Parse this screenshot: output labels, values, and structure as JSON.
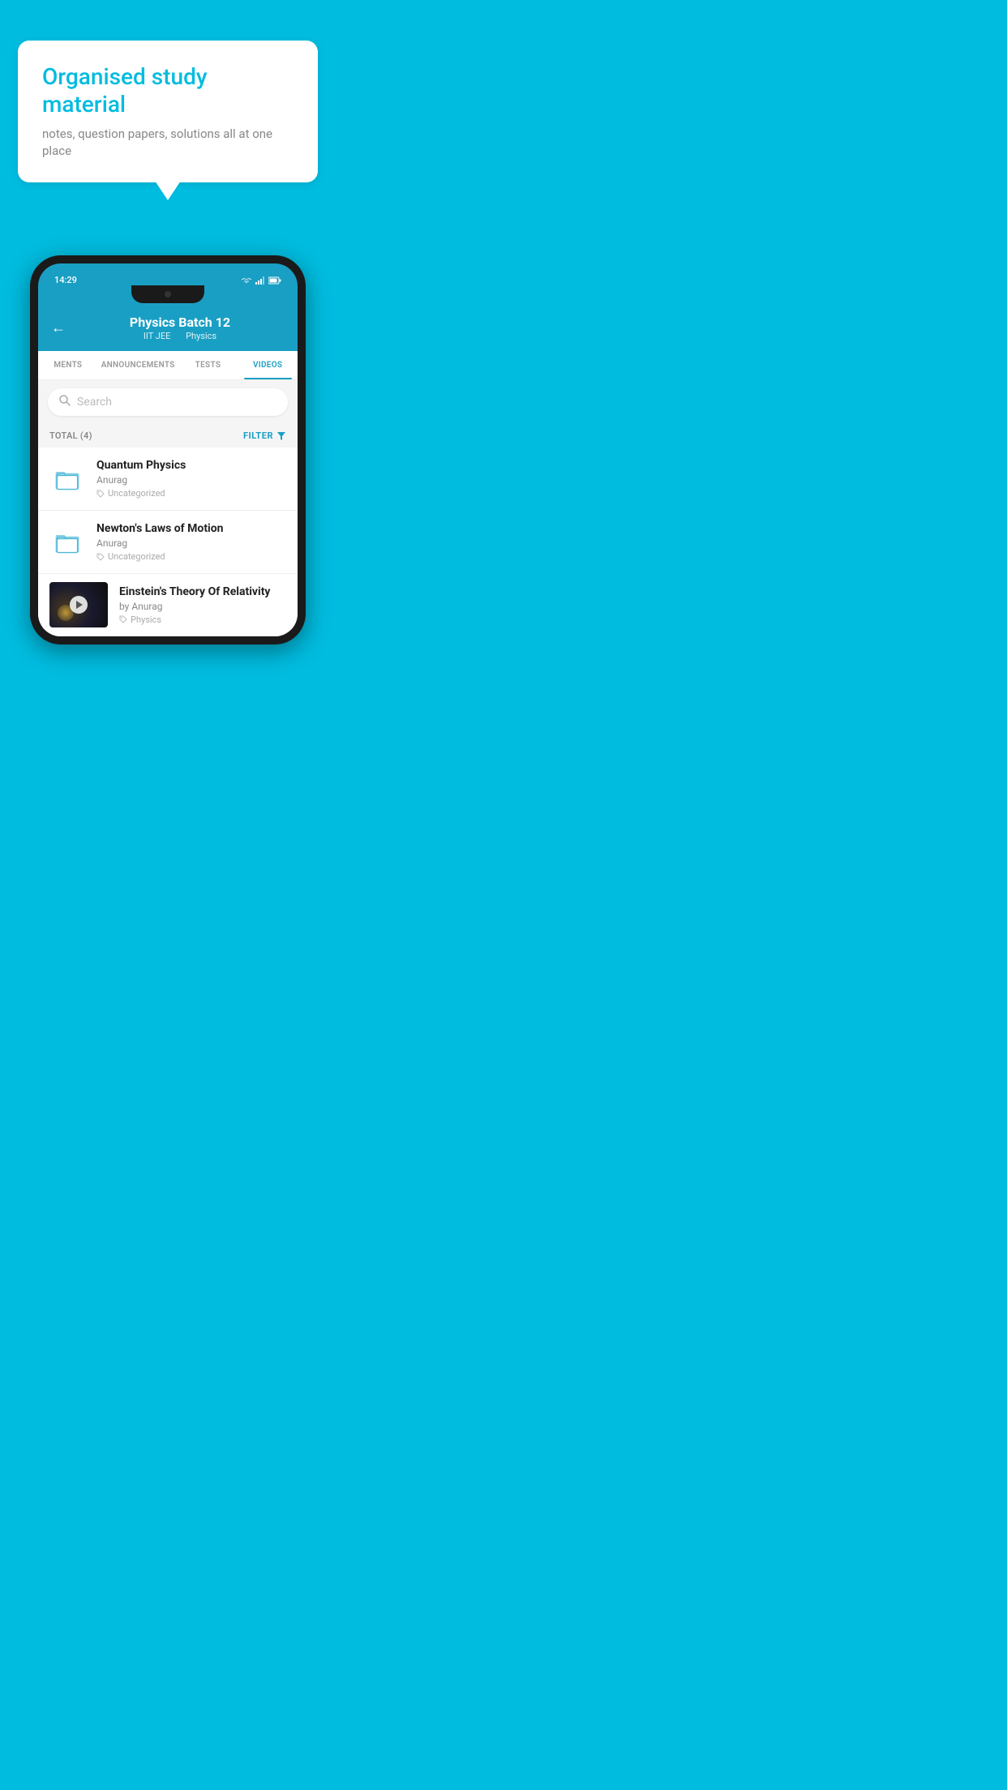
{
  "background_color": "#00BCDF",
  "speech_bubble": {
    "title": "Organised study material",
    "subtitle": "notes, question papers, solutions all at one place"
  },
  "phone": {
    "status_bar": {
      "time": "14:29",
      "icons": [
        "wifi",
        "signal",
        "battery"
      ]
    },
    "header": {
      "back_label": "←",
      "title": "Physics Batch 12",
      "subtitle_part1": "IIT JEE",
      "subtitle_part2": "Physics"
    },
    "tabs": [
      {
        "label": "MENTS",
        "active": false
      },
      {
        "label": "ANNOUNCEMENTS",
        "active": false
      },
      {
        "label": "TESTS",
        "active": false
      },
      {
        "label": "VIDEOS",
        "active": true
      }
    ],
    "search": {
      "placeholder": "Search"
    },
    "filter": {
      "total_label": "TOTAL (4)",
      "filter_label": "FILTER"
    },
    "videos": [
      {
        "title": "Quantum Physics",
        "author": "Anurag",
        "tag": "Uncategorized",
        "type": "folder",
        "has_thumbnail": false
      },
      {
        "title": "Newton's Laws of Motion",
        "author": "Anurag",
        "tag": "Uncategorized",
        "type": "folder",
        "has_thumbnail": false
      },
      {
        "title": "Einstein's Theory Of Relativity",
        "author": "by Anurag",
        "tag": "Physics",
        "type": "video",
        "has_thumbnail": true
      }
    ]
  }
}
